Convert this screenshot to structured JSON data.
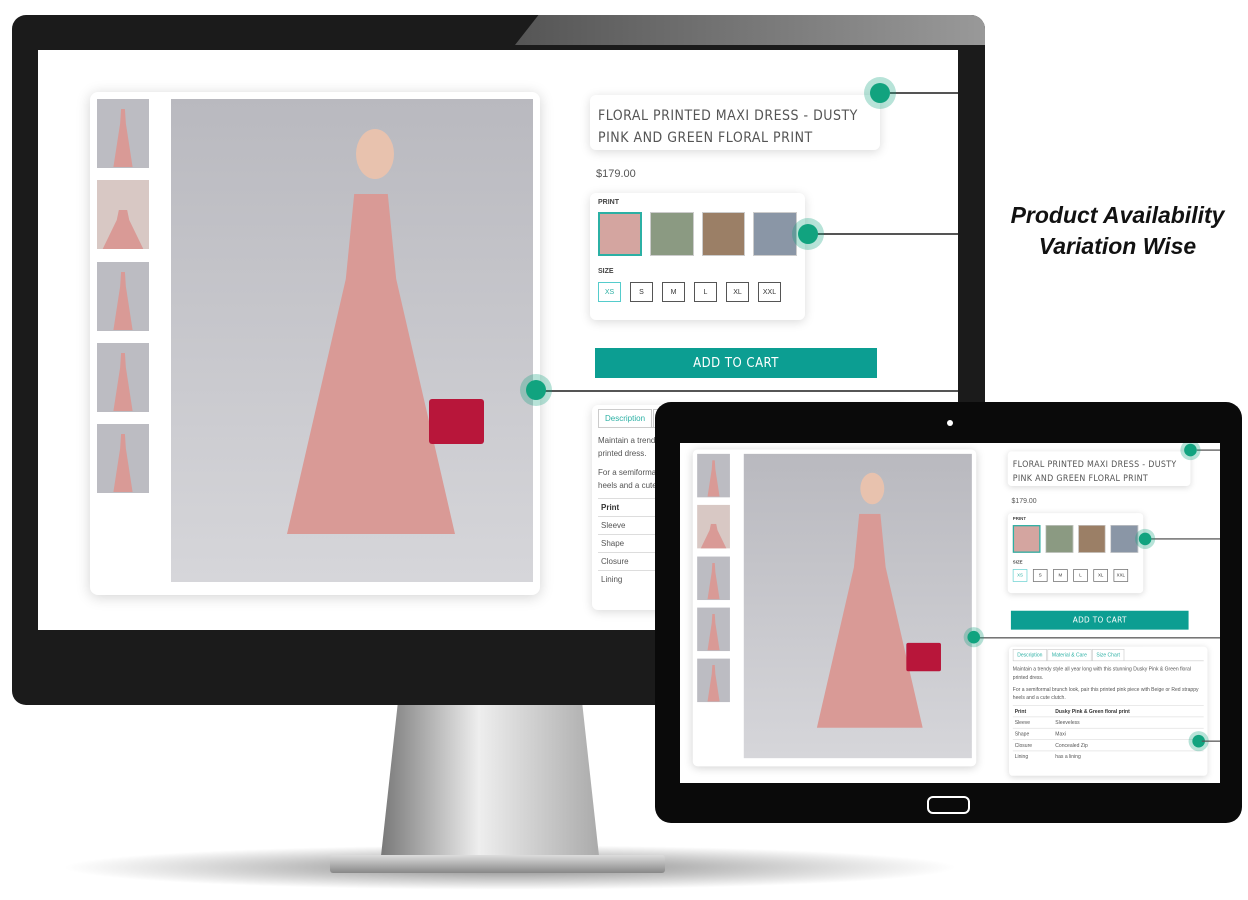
{
  "callout": {
    "line1": "Product Availability",
    "line2": "Variation Wise"
  },
  "product": {
    "title": "FLORAL PRINTED MAXI DRESS - DUSTY PINK AND GREEN FLORAL PRINT",
    "price": "$179.00",
    "print_label": "PRINT",
    "size_label": "SIZE",
    "sizes": [
      "XS",
      "S",
      "M",
      "L",
      "XL",
      "XXL"
    ],
    "selected_size": "XS",
    "add_to_cart": "ADD TO CART",
    "tabs": [
      "Description",
      "Material & Care",
      "Size Chart"
    ],
    "description": [
      "Maintain a trendy style all year long with this stunning Dusky Pink & Green floral printed dress.",
      "For a semiformal brunch look, pair this printed pink piece with Beige or Red strappy heels and a cute clutch."
    ],
    "specs": [
      [
        "Print",
        "Dusky Pink & Green floral print"
      ],
      [
        "Sleeve",
        "Sleeveless"
      ],
      [
        "Shape",
        "Maxi"
      ],
      [
        "Closure",
        "Concealed Zip"
      ],
      [
        "Lining",
        "has a lining"
      ]
    ]
  },
  "colors": {
    "accent": "#0c9e92",
    "dot": "#11a37f"
  }
}
